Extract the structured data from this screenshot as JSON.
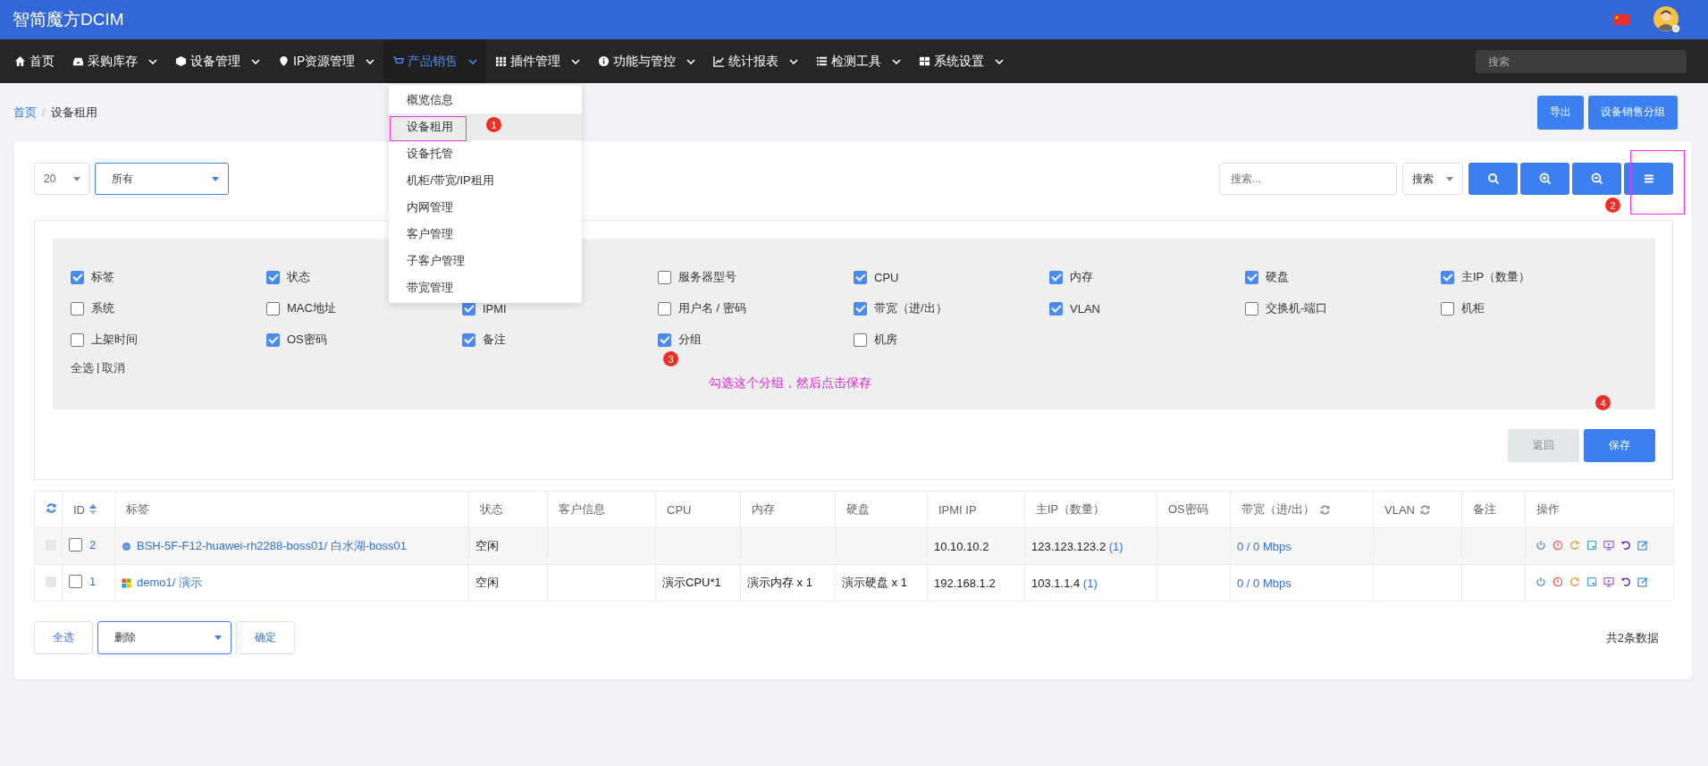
{
  "header": {
    "title": "智简魔方DCIM"
  },
  "nav": {
    "items": [
      {
        "label": "首页",
        "caret": false,
        "selected": false
      },
      {
        "label": "采购库存",
        "caret": true,
        "selected": false
      },
      {
        "label": "设备管理",
        "caret": true,
        "selected": false
      },
      {
        "label": "IP资源管理",
        "caret": true,
        "selected": false
      },
      {
        "label": "产品销售",
        "caret": true,
        "selected": true
      },
      {
        "label": "插件管理",
        "caret": true,
        "selected": false
      },
      {
        "label": "功能与管控",
        "caret": true,
        "selected": false
      },
      {
        "label": "统计报表",
        "caret": true,
        "selected": false
      },
      {
        "label": "检测工具",
        "caret": true,
        "selected": false
      },
      {
        "label": "系统设置",
        "caret": true,
        "selected": false
      }
    ],
    "search": {
      "placeholder": "搜索"
    }
  },
  "menu": {
    "items": [
      {
        "label": "概览信息",
        "selected": false
      },
      {
        "label": "设备租用",
        "selected": true
      },
      {
        "label": "设备托管",
        "selected": false
      },
      {
        "label": "机柜/带宽/IP租用",
        "selected": false
      },
      {
        "label": "内网管理",
        "selected": false
      },
      {
        "label": "客户管理",
        "selected": false
      },
      {
        "label": "子客户管理",
        "selected": false
      },
      {
        "label": "带宽管理",
        "selected": false
      }
    ]
  },
  "breadcrumb": {
    "items": [
      {
        "label": "首页",
        "link": true
      },
      {
        "label": "设备租用",
        "link": false
      }
    ],
    "separator": "/"
  },
  "page_actions": [
    "导出",
    "设备销售分组"
  ],
  "toolbar": {
    "page_size": "20",
    "filter": "所有",
    "search": {
      "placeholder": "搜索..."
    },
    "search_field": "搜索"
  },
  "columns_panel": {
    "rows": [
      [
        {
          "label": "标签",
          "checked": true
        },
        {
          "label": "状态",
          "checked": true
        },
        null,
        {
          "label": "服务器型号",
          "checked": false
        },
        {
          "label": "CPU",
          "checked": true
        },
        {
          "label": "内存",
          "checked": true
        },
        {
          "label": "硬盘",
          "checked": true
        },
        {
          "label": "主IP（数量）",
          "checked": true
        }
      ],
      [
        {
          "label": "系统",
          "checked": false
        },
        {
          "label": "MAC地址",
          "checked": false
        },
        {
          "label": "IPMI",
          "checked": true
        },
        {
          "label": "用户名 / 密码",
          "checked": false
        },
        {
          "label": "带宽（进/出）",
          "checked": true
        },
        {
          "label": "VLAN",
          "checked": true
        },
        {
          "label": "交换机-端口",
          "checked": false
        },
        {
          "label": "机柜",
          "checked": false
        }
      ],
      [
        {
          "label": "上架时间",
          "checked": false
        },
        {
          "label": "OS密码",
          "checked": true
        },
        {
          "label": "备注",
          "checked": true
        },
        {
          "label": "分组",
          "checked": true
        },
        {
          "label": "机房",
          "checked": false
        }
      ]
    ],
    "select_all": "全选",
    "separator": "|",
    "cancel": "取消",
    "buttons": [
      {
        "label": "返回",
        "kind": "secondary"
      },
      {
        "label": "保存",
        "kind": "primary"
      }
    ]
  },
  "table": {
    "columns": [
      {
        "refresh": true,
        "sort": false
      },
      {
        "label": "ID",
        "refresh": false,
        "sort": true
      },
      {
        "label": "标签",
        "refresh": false,
        "sort": false
      },
      {
        "label": "状态",
        "refresh": false,
        "sort": false
      },
      {
        "label": "客户信息",
        "refresh": false,
        "sort": false
      },
      {
        "label": "CPU",
        "refresh": false,
        "sort": false
      },
      {
        "label": "内存",
        "refresh": false,
        "sort": false
      },
      {
        "label": "硬盘",
        "refresh": false,
        "sort": false
      },
      {
        "label": "IPMI IP",
        "refresh": false,
        "sort": false
      },
      {
        "label": "主IP（数量）",
        "refresh": false,
        "sort": false
      },
      {
        "label": "OS密码",
        "refresh": false,
        "sort": false
      },
      {
        "label": "带宽（进/出）",
        "refresh": true,
        "sort": false
      },
      {
        "label": "VLAN",
        "refresh": true,
        "sort": false
      },
      {
        "label": "备注",
        "refresh": false,
        "sort": false
      },
      {
        "label": "操作",
        "refresh": false,
        "sort": false
      }
    ],
    "rows": [
      {
        "disabled": true,
        "checked": false,
        "id": "2",
        "kind": "dot",
        "label": "BSH-5F-F12-huawei-rh2288-boss01/ 白水湖-boss01",
        "status": "空闲",
        "ipmi_ip": "10.10.10.2",
        "main_ip": "123.123.123.2",
        "ip_count": "(1)",
        "bandwidth": "0 / 0 Mbps"
      },
      {
        "disabled": true,
        "checked": false,
        "id": "1",
        "kind": "windows",
        "label": "demo1/ 演示",
        "status": "空闲",
        "cpu": "演示CPU*1",
        "memory": "演示内存 x 1",
        "disk": "演示硬盘 x 1",
        "ipmi_ip": "192.168.1.2",
        "main_ip": "103.1.1.4",
        "ip_count": "(1)",
        "bandwidth": "0 / 0 Mbps"
      }
    ]
  },
  "bulk": {
    "select_all": "全选",
    "action": "删除",
    "confirm": "确定"
  },
  "total": "共2条数据",
  "annotations": {
    "markers": [
      "1",
      "2",
      "3",
      "4"
    ],
    "note": "勾选这个分组，然后点击保存"
  }
}
